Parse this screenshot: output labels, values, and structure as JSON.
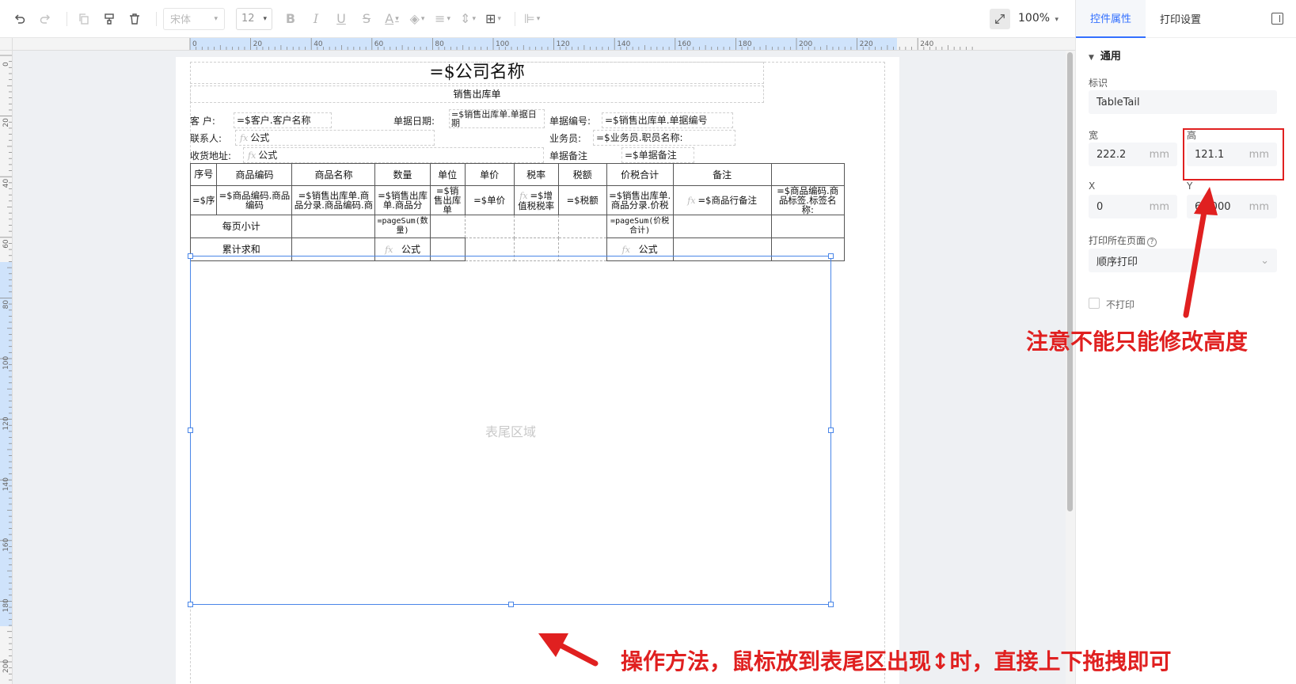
{
  "toolbar": {
    "font_name": "宋体",
    "font_size": "12",
    "zoom": "100%"
  },
  "ruler": {
    "h_ticks": [
      "0",
      "20",
      "40",
      "60",
      "80",
      "100",
      "120",
      "140",
      "160",
      "180",
      "200",
      "220",
      "240"
    ],
    "v_ticks": [
      "0",
      "20",
      "40",
      "60",
      "80",
      "100",
      "120",
      "140",
      "160",
      "180",
      "200"
    ]
  },
  "doc": {
    "title": "=$公司名称",
    "subtitle": "销售出库单",
    "customer_label": "客  户:",
    "customer_value": "=$客户.客户名称",
    "date_label": "单据日期:",
    "date_value": "=$销售出库单.单据日期",
    "no_label": "单据编号:",
    "no_value": "=$销售出库单.单据编号",
    "contact_label": "联系人:",
    "contact_value": "公式",
    "salesman_label": "业务员:",
    "salesman_value": "=$业务员.职员名称:",
    "address_label": "收货地址:",
    "address_value": "公式",
    "remark_label": "单据备注",
    "remark_value": "=$单据备注",
    "table_headers": [
      "序号",
      "商品编码",
      "商品名称",
      "数量",
      "单位",
      "单价",
      "税率",
      "税额",
      "价税合计",
      "备注",
      ""
    ],
    "table_data_row": [
      "=$序",
      "=$商品编码.商品编码",
      "=$销售出库单.商品分录.商品编码.商",
      "=$销售出库单.商品分",
      "=$销售出库单",
      "=$单价",
      "=$增值税税率",
      "=$税额",
      "=$销售出库单.商品分录.价税",
      "=$商品行备注",
      "=$商品编码.商品标签.标签名称:"
    ],
    "subtotal_label": "每页小计",
    "subtotal_qty": "=pageSum(数量)",
    "subtotal_total": "=pageSum(价税合计)",
    "cumulative_label": "累计求和",
    "formula": "公式",
    "tail_label": "表尾区域"
  },
  "panel": {
    "tab_props": "控件属性",
    "tab_print": "打印设置",
    "section": "通用",
    "id_label": "标识",
    "id_value": "TableTail",
    "width_label": "宽",
    "width_value": "222.2",
    "height_label": "高",
    "height_value": "121.1",
    "x_label": "X",
    "x_value": "0",
    "y_label": "Y",
    "y_value": "65.000",
    "unit": "mm",
    "print_page_label": "打印所在页面",
    "print_page_value": "顺序打印",
    "no_print_label": "不打印"
  },
  "annotations": {
    "note_height": "注意不能只能修改高度",
    "note_drag": "操作方法，鼠标放到表尾区出现↕时，直接上下拖拽即可",
    "color": "#e02020"
  }
}
